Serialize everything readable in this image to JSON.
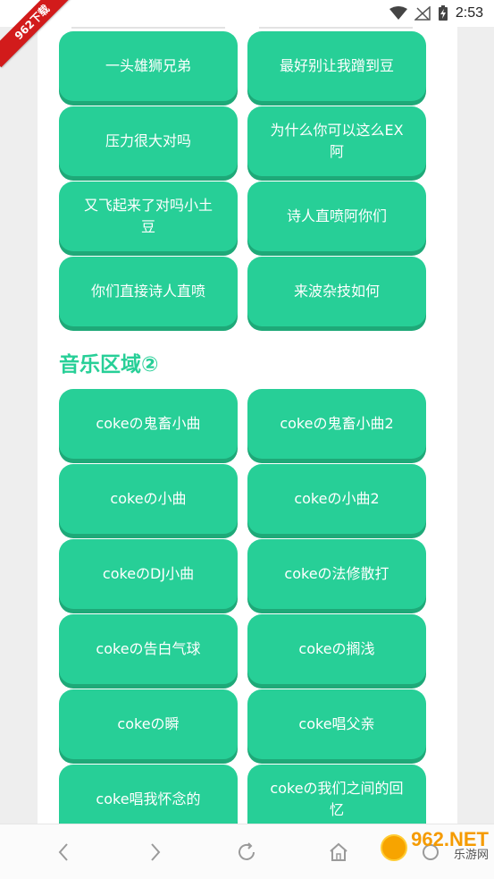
{
  "status_bar": {
    "time": "2:53",
    "icons": [
      "wifi-icon",
      "signal-off-icon",
      "battery-charging-icon"
    ]
  },
  "ribbon": {
    "label": "962下载"
  },
  "section1": {
    "buttons": [
      "一头雄狮兄弟",
      "最好别让我蹭到豆",
      "压力很大对吗",
      "为什么你可以这么EX阿",
      "又飞起来了对吗小土豆",
      "诗人直喷阿你们",
      "你们直接诗人直喷",
      "来波杂技如何"
    ]
  },
  "section2": {
    "title": "音乐区域②",
    "buttons": [
      "cokeの鬼畜小曲",
      "cokeの鬼畜小曲2",
      "cokeの小曲",
      "cokeの小曲2",
      "cokeのDJ小曲",
      "cokeの法修散打",
      "cokeの告白气球",
      "cokeの搁浅",
      "cokeの瞬",
      "coke唱父亲",
      "coke唱我怀念的",
      "cokeの我们之间的回忆"
    ]
  },
  "navbar": {
    "icons": [
      "back-icon",
      "forward-icon",
      "refresh-icon",
      "home-icon",
      "tabs-icon"
    ]
  },
  "watermark": {
    "main": "962.NET",
    "sub": "乐游网"
  },
  "colors": {
    "accent": "#27cf97",
    "accent_shadow": "#1ea978",
    "ribbon": "#d21b1b"
  }
}
